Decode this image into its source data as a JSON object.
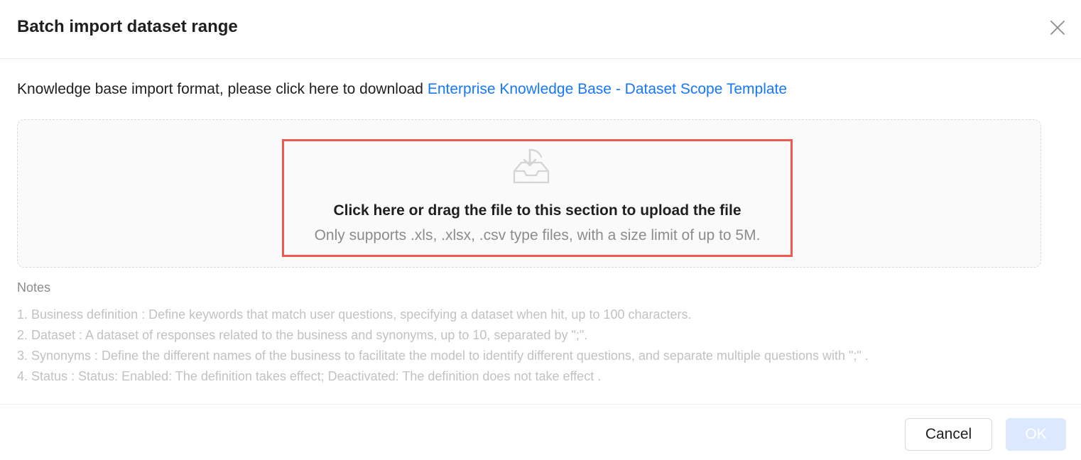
{
  "dialog": {
    "title": "Batch import dataset range",
    "close_icon": "close-icon"
  },
  "intro": {
    "text": "Knowledge base import format, please click here to download ",
    "link_text": "Enterprise Knowledge Base - Dataset Scope Template",
    "link_color": "#1677ff"
  },
  "upload": {
    "icon": "inbox-download-icon",
    "title": "Click here or drag the file to this section to upload the file",
    "hint": "Only supports .xls, .xlsx, .csv type files, with a size limit of up to 5M.",
    "highlight_color": "#ee5a4f"
  },
  "notes": {
    "title": "Notes",
    "items": [
      "1. Business definition : Define keywords that match user questions, specifying a dataset when hit, up to 100 characters.",
      "2. Dataset : A dataset of responses related to the business and synonyms, up to 10, separated by \";\".",
      "3. Synonyms : Define the different names of the business to facilitate the model to identify different questions, and separate multiple questions with \";\" .",
      "4. Status : Status: Enabled: The definition takes effect; Deactivated: The definition does not take effect ."
    ]
  },
  "footer": {
    "cancel_label": "Cancel",
    "ok_label": "OK",
    "ok_disabled": true,
    "primary_color": "#1677ff",
    "primary_disabled_color": "#dbe8fd"
  }
}
